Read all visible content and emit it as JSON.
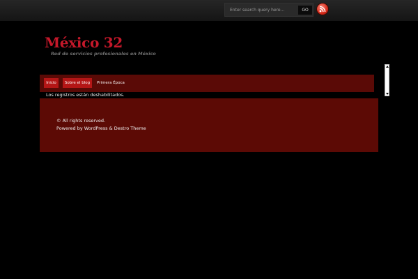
{
  "search": {
    "placeholder": "Enter search query here...",
    "button_label": "GO"
  },
  "header": {
    "logo_text": "México 32",
    "tagline": "Red de servicios profesionales en México"
  },
  "nav": {
    "items": [
      {
        "label": "Inicio"
      },
      {
        "label": "Sobre el blog"
      },
      {
        "label": "Primera Época"
      }
    ]
  },
  "main": {
    "comments_note": "Los registros están deshabilitados."
  },
  "footer": {
    "copyright": "© All rights reserved.",
    "powered_by": "Powered by WordPress & Destro Theme"
  },
  "icons": {
    "rss": "rss-feed-icon"
  },
  "colors": {
    "background": "#000000",
    "brand_red": "#c4182a",
    "nav_bg": "#5a0a06",
    "nav_active": "#b41616",
    "footer_bg": "#5c0a05"
  }
}
